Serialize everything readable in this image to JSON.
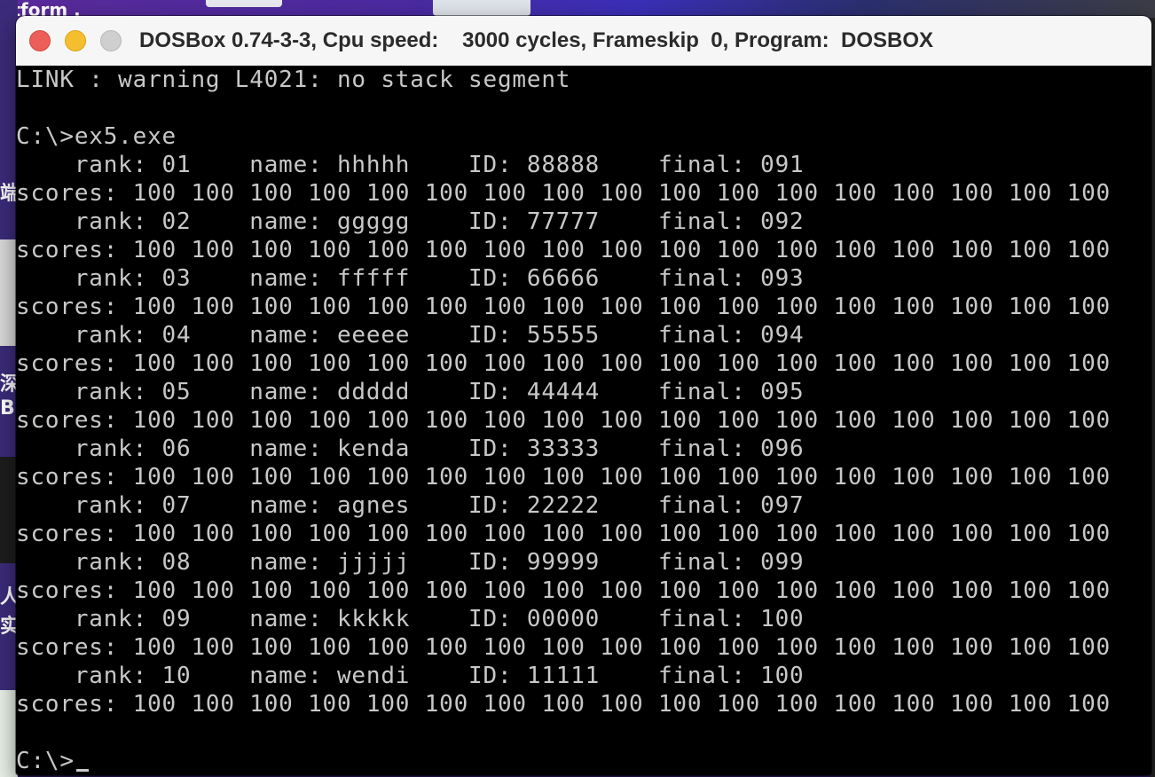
{
  "desktop": {
    "fragment_top": "atform .",
    "fragment_left": [
      "端",
      "深",
      "B",
      "人",
      "实"
    ]
  },
  "window": {
    "title": "DOSBox 0.74-3-3, Cpu speed:    3000 cycles, Frameskip  0, Program:  DOSBOX"
  },
  "console": {
    "warning": "LINK : warning L4021: no stack segment",
    "command": "C:\\>ex5.exe",
    "records": [
      {
        "line": "    rank: 01    name: hhhhh    ID: 88888    final: 091",
        "scores": "scores: 100 100 100 100 100 100 100 100 100 100 100 100 100 100 100 100 100"
      },
      {
        "line": "    rank: 02    name: ggggg    ID: 77777    final: 092",
        "scores": "scores: 100 100 100 100 100 100 100 100 100 100 100 100 100 100 100 100 100"
      },
      {
        "line": "    rank: 03    name: fffff    ID: 66666    final: 093",
        "scores": "scores: 100 100 100 100 100 100 100 100 100 100 100 100 100 100 100 100 100"
      },
      {
        "line": "    rank: 04    name: eeeee    ID: 55555    final: 094",
        "scores": "scores: 100 100 100 100 100 100 100 100 100 100 100 100 100 100 100 100 100"
      },
      {
        "line": "    rank: 05    name: ddddd    ID: 44444    final: 095",
        "scores": "scores: 100 100 100 100 100 100 100 100 100 100 100 100 100 100 100 100 100"
      },
      {
        "line": "    rank: 06    name: kenda    ID: 33333    final: 096",
        "scores": "scores: 100 100 100 100 100 100 100 100 100 100 100 100 100 100 100 100 100"
      },
      {
        "line": "    rank: 07    name: agnes    ID: 22222    final: 097",
        "scores": "scores: 100 100 100 100 100 100 100 100 100 100 100 100 100 100 100 100 100"
      },
      {
        "line": "    rank: 08    name: jjjjj    ID: 99999    final: 099",
        "scores": "scores: 100 100 100 100 100 100 100 100 100 100 100 100 100 100 100 100 100"
      },
      {
        "line": "    rank: 09    name: kkkkk    ID: 00000    final: 100",
        "scores": "scores: 100 100 100 100 100 100 100 100 100 100 100 100 100 100 100 100 100"
      },
      {
        "line": "    rank: 10    name: wendi    ID: 11111    final: 100",
        "scores": "scores: 100 100 100 100 100 100 100 100 100 100 100 100 100 100 100 100 100"
      }
    ],
    "prompt": "C:\\>"
  },
  "colors": {
    "console_text": "#c8c8c8",
    "console_bg": "#000000",
    "close": "#ec5f58",
    "minimize": "#f5be2f",
    "zoom_disabled": "#cfcfcf"
  }
}
